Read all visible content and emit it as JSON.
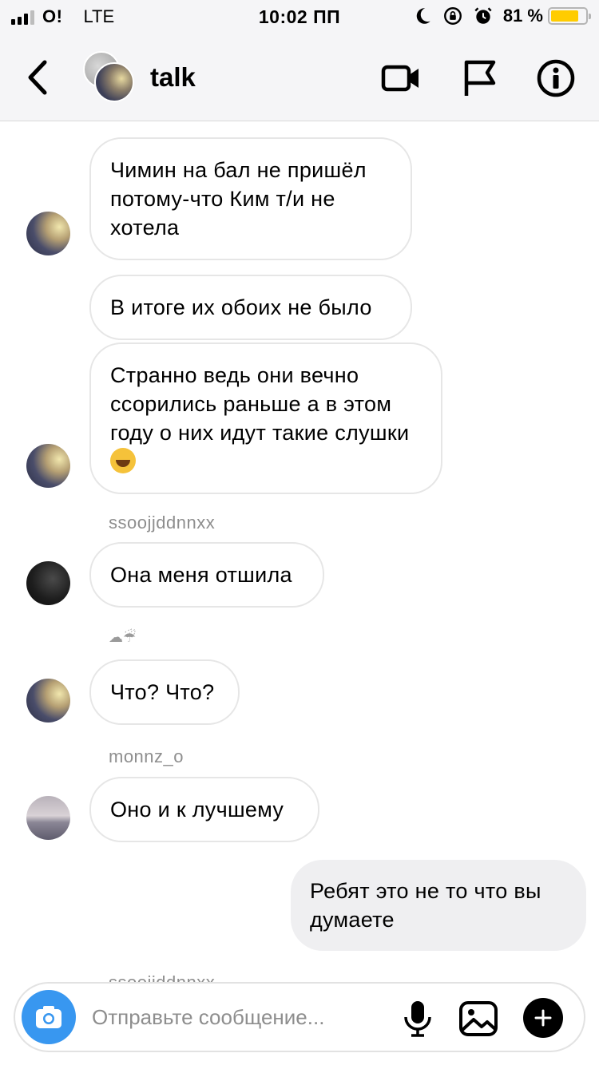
{
  "status_bar": {
    "carrier": "O!",
    "network": "LTE",
    "time": "10:02 ПП",
    "battery_percent": "81 %",
    "battery_level": 0.81,
    "icons": [
      "moon-icon",
      "rotation-lock-icon",
      "alarm-icon"
    ]
  },
  "header": {
    "back_icon": "chevron-left-icon",
    "title": "talk",
    "actions": [
      "video-call-icon",
      "flag-icon",
      "info-icon"
    ]
  },
  "messages": [
    {
      "type": "incoming",
      "text": "Чимин на бал не пришёл потому-что Ким т/и не хотела"
    },
    {
      "type": "incoming",
      "text": "В итоге их обоих не было"
    },
    {
      "type": "incoming",
      "text": "Странно ведь они вечно ссорились раньше а в этом году о них идут такие слушки"
    },
    {
      "type": "sender",
      "text": "ssoojjddnnxx"
    },
    {
      "type": "incoming",
      "text": "Она меня отшила"
    },
    {
      "type": "sender",
      "text": "☁☔"
    },
    {
      "type": "incoming",
      "text": "Что? Что?"
    },
    {
      "type": "sender",
      "text": "monnz_o"
    },
    {
      "type": "incoming",
      "text": "Оно и к лучшему"
    },
    {
      "type": "outgoing",
      "text": "Ребят это не то что вы думаете"
    },
    {
      "type": "sender",
      "text": "ssoojjddnnxx"
    }
  ],
  "composer": {
    "placeholder": "Отправьте сообщение...",
    "icons": [
      "camera-icon",
      "microphone-icon",
      "gallery-icon",
      "plus-icon"
    ]
  },
  "colors": {
    "accent": "#3897f0",
    "bar_bg": "#f5f5f7",
    "outgoing_bubble": "#efeff1",
    "battery": "#ffcc00"
  }
}
